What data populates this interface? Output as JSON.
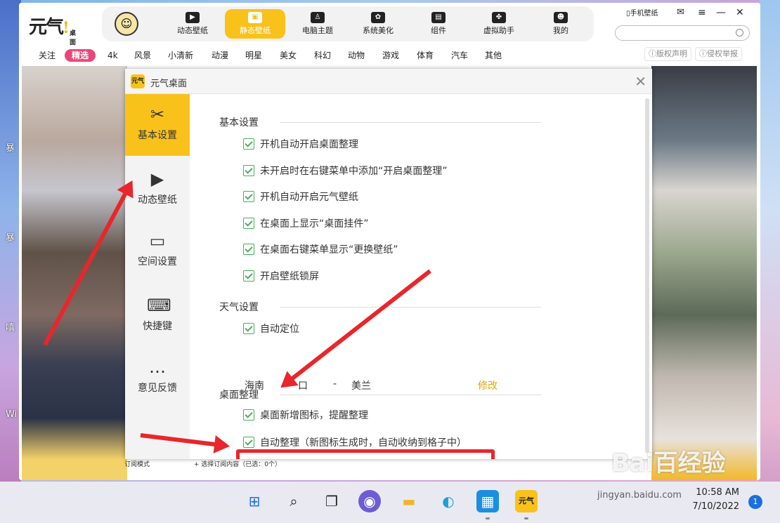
{
  "desktop": {
    "labels": [
      "暴",
      "暴",
      "嗔",
      "Wi"
    ]
  },
  "app": {
    "logo": {
      "main": "元气",
      "heart": "!",
      "sub": "桌面"
    },
    "nav": [
      {
        "label": "动态壁纸",
        "icon": "play-icon",
        "glyph": "▶"
      },
      {
        "label": "静态壁纸",
        "icon": "image-icon",
        "glyph": "▣"
      },
      {
        "label": "电脑主题",
        "icon": "shirt-icon",
        "glyph": "♙"
      },
      {
        "label": "系统美化",
        "icon": "flower-icon",
        "glyph": "✿"
      },
      {
        "label": "组件",
        "icon": "widget-icon",
        "glyph": "▤"
      },
      {
        "label": "虚拟助手",
        "icon": "paw-icon",
        "glyph": "✤"
      },
      {
        "label": "我的",
        "icon": "face-icon",
        "glyph": "☻"
      }
    ],
    "top_right": {
      "phone": "手机壁纸",
      "mail_icon": "mail-icon",
      "menu_icon": "menu-icon",
      "min_icon": "minimize-icon",
      "close_icon": "close-icon"
    },
    "search": {
      "placeholder": "",
      "value": ""
    },
    "categories": [
      "关注",
      "精选",
      "4k",
      "风景",
      "小清新",
      "动漫",
      "明星",
      "美女",
      "科幻",
      "动物",
      "游戏",
      "体育",
      "汽车",
      "其他"
    ],
    "active_category": "精选",
    "links": {
      "copyright": "版权声明",
      "report": "侵权举报"
    },
    "bottom": {
      "mode": "订阅模式",
      "sub": "+ 选择订阅内容（已选：0个）"
    }
  },
  "dialog": {
    "title": "元气桌面",
    "sidebar": [
      {
        "label": "基本设置",
        "icon": "tools-icon",
        "glyph": "✂",
        "active": true
      },
      {
        "label": "动态壁纸",
        "icon": "play-icon",
        "glyph": "▶",
        "active": false
      },
      {
        "label": "空间设置",
        "icon": "disk-icon",
        "glyph": "▭",
        "active": false
      },
      {
        "label": "快捷键",
        "icon": "keyboard-icon",
        "glyph": "⌨",
        "active": false
      },
      {
        "label": "意见反馈",
        "icon": "chat-icon",
        "glyph": "…",
        "active": false
      }
    ],
    "sections": {
      "basic": {
        "title": "基本设置",
        "options": [
          "开机自动开启桌面整理",
          "未开启时在右键菜单中添加“开启桌面整理”",
          "开机自动开启元气壁纸",
          "在桌面上显示“桌面挂件”",
          "在桌面右键菜单显示“更换壁纸”",
          "开启壁纸锁屏"
        ]
      },
      "weather": {
        "title": "天气设置",
        "options": [
          "自动定位"
        ],
        "location": {
          "province": "海南",
          "city": "口",
          "dash": "-",
          "district": "美兰"
        },
        "modify": "修改"
      },
      "organize": {
        "title": "桌面整理",
        "options": [
          "桌面新增图标，提醒整理",
          "自动整理（新图标生成时，自动收纳到格子中）"
        ]
      }
    }
  },
  "taskbar": {
    "clock_time": "10:58 AM",
    "clock_date": "7/10/2022",
    "notifications": "1"
  },
  "watermark": {
    "brand": "Bai百经验",
    "url": "jingyan.baidu.com"
  }
}
